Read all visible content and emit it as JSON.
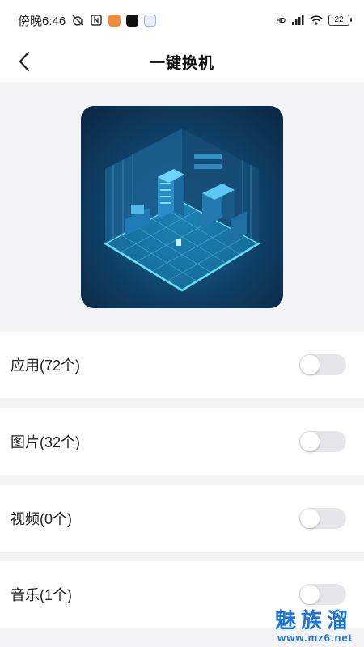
{
  "status_bar": {
    "time": "傍晚6:46",
    "network_label": "HD",
    "battery": "22"
  },
  "header": {
    "title": "一键换机"
  },
  "hero": {
    "description": "isometric server room illustration"
  },
  "options": [
    {
      "label": "应用(72个)",
      "enabled": false
    },
    {
      "label": "图片(32个)",
      "enabled": false
    },
    {
      "label": "视频(0个)",
      "enabled": false
    },
    {
      "label": "音乐(1个)",
      "enabled": false
    }
  ],
  "watermark": {
    "brand": "魅族溜",
    "url": "www.mz6.net"
  },
  "colors": {
    "accent": "#1b73d8",
    "toggle_off": "#e6e6ea",
    "background": "#f3f3f6"
  }
}
